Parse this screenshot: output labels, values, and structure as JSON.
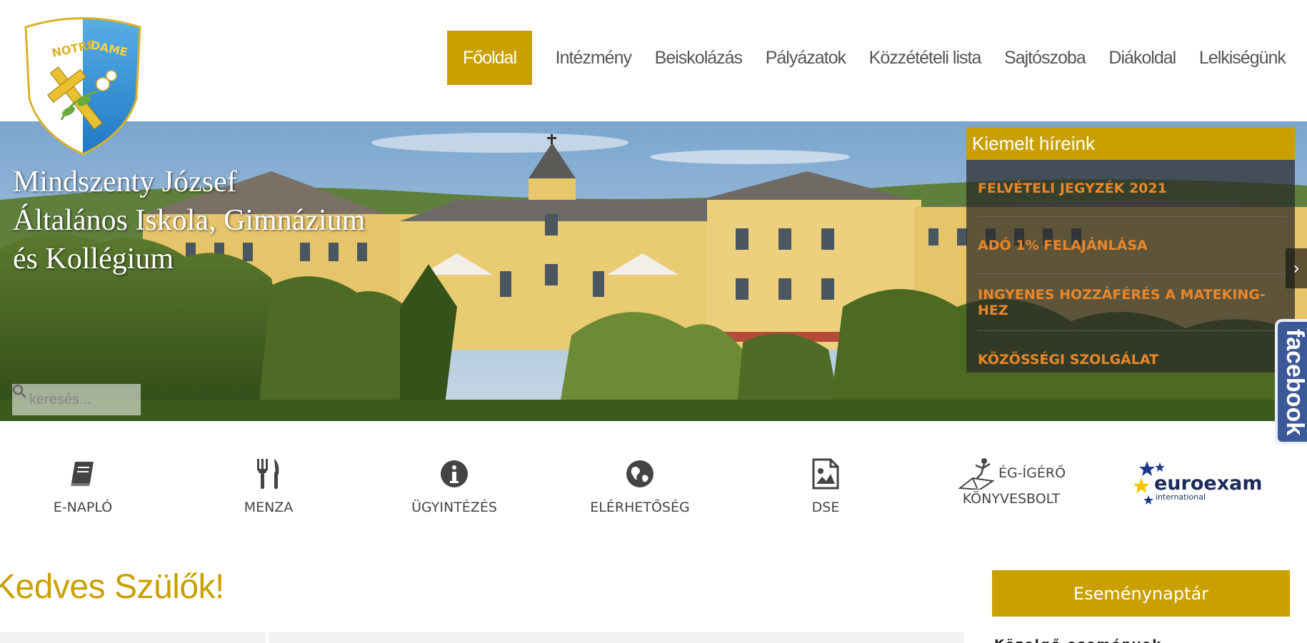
{
  "brand": {
    "logo_text_left": "NOTRE",
    "logo_text_right": "DAME",
    "colors": {
      "gold": "#c9a000",
      "blue": "#2a8fd6",
      "news_orange": "#e8872a",
      "facebook": "#3b5998"
    }
  },
  "nav": {
    "items": [
      {
        "label": "Főoldal",
        "active": true
      },
      {
        "label": "Intézmény"
      },
      {
        "label": "Beiskolázás"
      },
      {
        "label": "Pályázatok"
      },
      {
        "label": "Közzétételi lista"
      },
      {
        "label": "Sajtószoba"
      },
      {
        "label": "Diákoldal"
      },
      {
        "label": "Lelkiségünk"
      }
    ]
  },
  "hero": {
    "title_lines": [
      "Mindszenty József",
      "Általános Iskola, Gimnázium",
      "és Kollégium"
    ],
    "search": {
      "placeholder": "keresés...",
      "icon": "search-icon"
    },
    "next_arrow": "›"
  },
  "news": {
    "heading": "Kiemelt híreink",
    "items": [
      "FELVÉTELI JEGYZÉK 2021",
      "ADÓ 1% FELAJÁNLÁSA",
      "INGYENES HOZZÁFÉRÉS A MATEKING-HEZ",
      "KÖZÖSSÉGI SZOLGÁLAT"
    ]
  },
  "facebook": {
    "label": "facebook"
  },
  "quick_links": [
    {
      "label": "E-NAPLÓ",
      "icon": "book-icon"
    },
    {
      "label": "MENZA",
      "icon": "fork-knife-icon"
    },
    {
      "label": "ÜGYINTÉZÉS",
      "icon": "info-icon"
    },
    {
      "label": "ELÉRHETŐSÉG",
      "icon": "globe-icon"
    },
    {
      "label": "DSE",
      "icon": "image-file-icon"
    },
    {
      "label_line1": "ÉG-ÍGÉRŐ",
      "label_line2": "KÖNYVESBOLT",
      "icon": "bookstore-logo-icon"
    },
    {
      "logo_text": "euroexam",
      "logo_sub": "international",
      "icon": "euroexam-logo"
    }
  ],
  "main": {
    "greeting": "Kedves Szülők!"
  },
  "sidebar": {
    "event_button": "Eseménynaptár",
    "partial_text": "Közelgő események"
  }
}
